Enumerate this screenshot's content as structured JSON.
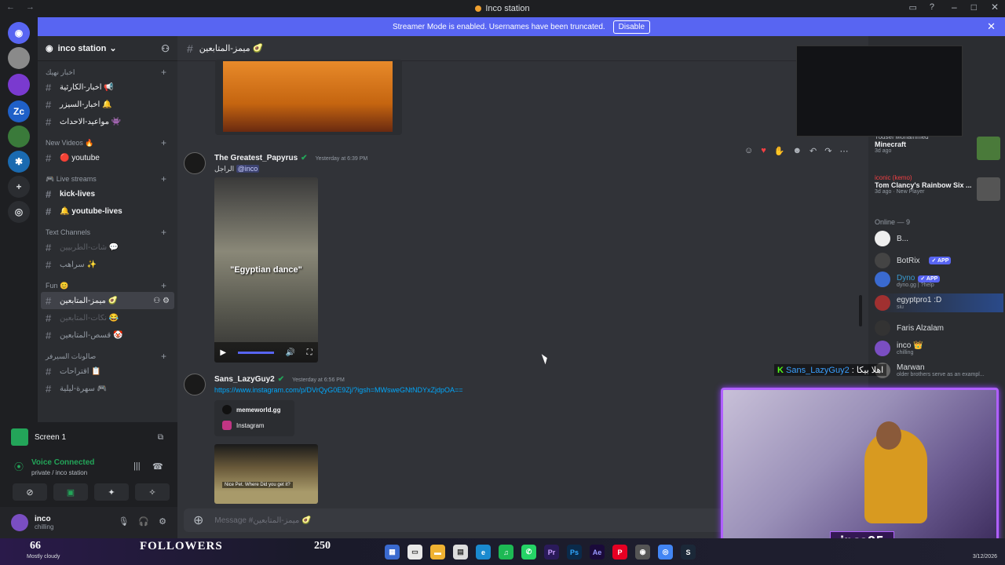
{
  "window": {
    "title": "Inco station"
  },
  "banner": {
    "text": "Streamer Mode is enabled. Usernames have been truncated.",
    "button": "Disable"
  },
  "guild": {
    "name": "inco station"
  },
  "categories": [
    {
      "name": "اخبار نهيك",
      "channels": [
        {
          "name": "اخبار-الكارثية 📢"
        },
        {
          "name": "اخبار-السيزر 🔔"
        },
        {
          "name": "مواعيد-الاحداث 👾"
        }
      ]
    },
    {
      "name": "New Videos 🔥",
      "channels": [
        {
          "name": "🔴 youtube"
        }
      ]
    },
    {
      "name": "🎮 Live streams",
      "channels": [
        {
          "name": "kick-lives"
        },
        {
          "name": "🔔 youtube-lives"
        }
      ]
    },
    {
      "name": "Text Channels",
      "channels": [
        {
          "name": "شات-الطربيين 💬"
        },
        {
          "name": "سراهب ✨"
        }
      ]
    },
    {
      "name": "Fun 😊",
      "channels": [
        {
          "name": "ميمز-المتابعين 🥑"
        },
        {
          "name": "نكات-المتابعين 😂"
        },
        {
          "name": "قسص-المتابعين 🤡"
        }
      ]
    },
    {
      "name": "صالونات السيرفر",
      "channels": [
        {
          "name": "اقتراحات 📋"
        },
        {
          "name": "سهرة-ليلية 🎮"
        }
      ]
    }
  ],
  "screen": {
    "label": "Screen 1"
  },
  "voice": {
    "status": "Voice Connected",
    "location": "private / inco station"
  },
  "user": {
    "name": "inco",
    "status": "chilling"
  },
  "channel": {
    "name": "ميمز-المتابعين 🥑",
    "input_placeholder": "Message #ميمز-المتابعين 🥑"
  },
  "messages": [
    {
      "author": "The Greatest_Papyrus",
      "time": "Yesterday at 6:39 PM",
      "text": "الراجل",
      "mention": "@inco",
      "video_caption": "\"Egyptian dance\""
    },
    {
      "author": "Sans_LazyGuy2",
      "time": "Yesterday at 6:56 PM",
      "link": "https://www.instagram.com/p/DVrQyG0E9Zj/?igsh=MWsweGNtNDYxZjdpOA==",
      "embed_site": "memeworld.gg",
      "embed_source": "Instagram",
      "thumb_caption": "Nice Pet. Where Did you get it?"
    }
  ],
  "members": {
    "activities": [
      {
        "user": "Yousef Mohammed",
        "game": "Minecraft",
        "when": "3d ago"
      },
      {
        "user": "iconic (kemo)",
        "game": "Tom Clancy's Rainbow Six ...",
        "when": "3d ago · New Player"
      }
    ],
    "online_header": "Online — 9",
    "list": [
      {
        "name": "B...",
        "status": "",
        "tag": ""
      },
      {
        "name": "BotRix",
        "status": "",
        "tag": "✓ APP"
      },
      {
        "name": "Dyno",
        "status": "dyno.gg | ?help",
        "tag": "✓ APP"
      },
      {
        "name": "egyptpro1 :D",
        "status": "siu",
        "tag": ""
      },
      {
        "name": "Faris Alzalam",
        "status": "",
        "tag": ""
      },
      {
        "name": "inco 👑",
        "status": "chilling",
        "tag": ""
      },
      {
        "name": "Marwan",
        "status": "older brothers serve as an exampl...",
        "tag": ""
      }
    ]
  },
  "overlay": {
    "chat_user": "Sans_LazyGuy2",
    "chat_text": ": اهلا بيكا",
    "webcam_tag": "inco95"
  },
  "taskbar": {
    "temp": "66",
    "weather": "Mostly cloudy",
    "followers_label": "FOLLOWERS",
    "followers_count": "250",
    "date": "3/12/2026"
  },
  "colors": {
    "accent": "#5865f2",
    "online": "#23a559",
    "link": "#00a8fc",
    "stream_border": "#b060ff"
  }
}
